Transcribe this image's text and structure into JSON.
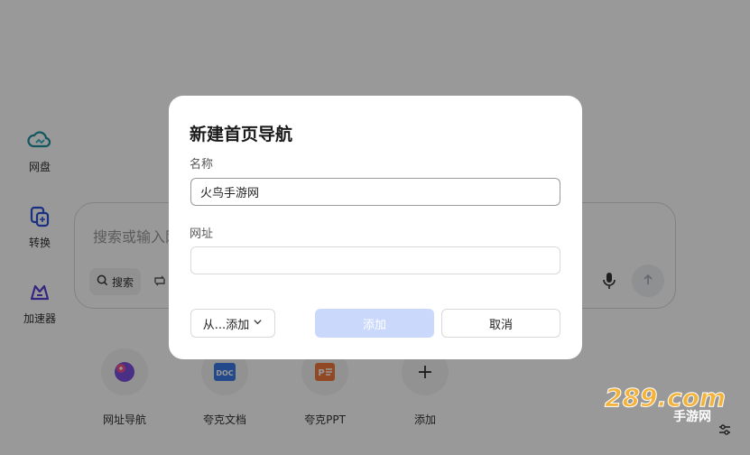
{
  "sidebar": {
    "items": [
      {
        "label": "网盘",
        "icon": "cloud-drive-icon"
      },
      {
        "label": "转换",
        "icon": "convert-icon"
      },
      {
        "label": "加速器",
        "icon": "accelerator-icon"
      }
    ]
  },
  "search": {
    "placeholder": "搜索或输入网",
    "chip_label": "搜索"
  },
  "shortcuts": [
    {
      "label": "网址导航",
      "icon": "nav-icon"
    },
    {
      "label": "夸克文档",
      "icon": "doc-icon",
      "badge": "DOC"
    },
    {
      "label": "夸克PPT",
      "icon": "ppt-icon",
      "badge": "P"
    },
    {
      "label": "添加",
      "icon": "plus-icon",
      "glyph": "+"
    }
  ],
  "dialog": {
    "title": "新建首页导航",
    "name_label": "名称",
    "name_value": "火鸟手游网",
    "url_label": "网址",
    "url_value": "",
    "from_label": "从...添加",
    "add_label": "添加",
    "cancel_label": "取消"
  },
  "watermark": {
    "text": "289.com",
    "sub": "手游网"
  },
  "colors": {
    "accent": "#3b6ef5",
    "add_disabled": "#c9d8fb",
    "overlay": "rgba(0,0,0,0.40)"
  }
}
